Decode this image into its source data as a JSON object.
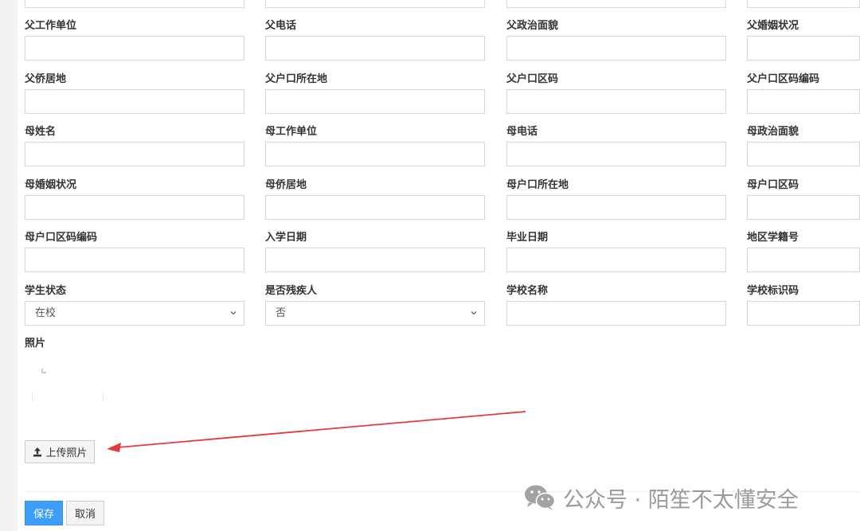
{
  "form": {
    "rows": [
      [
        {
          "label": "父工作单位",
          "value": ""
        },
        {
          "label": "父电话",
          "value": ""
        },
        {
          "label": "父政治面貌",
          "value": ""
        },
        {
          "label": "父婚姻状况",
          "value": ""
        }
      ],
      [
        {
          "label": "父侨居地",
          "value": ""
        },
        {
          "label": "父户口所在地",
          "value": ""
        },
        {
          "label": "父户口区码",
          "value": ""
        },
        {
          "label": "父户口区码编码",
          "value": ""
        }
      ],
      [
        {
          "label": "母姓名",
          "value": ""
        },
        {
          "label": "母工作单位",
          "value": ""
        },
        {
          "label": "母电话",
          "value": ""
        },
        {
          "label": "母政治面貌",
          "value": ""
        }
      ],
      [
        {
          "label": "母婚姻状况",
          "value": ""
        },
        {
          "label": "母侨居地",
          "value": ""
        },
        {
          "label": "母户口所在地",
          "value": ""
        },
        {
          "label": "母户口区码",
          "value": ""
        }
      ],
      [
        {
          "label": "母户口区码编码",
          "value": ""
        },
        {
          "label": "入学日期",
          "value": ""
        },
        {
          "label": "毕业日期",
          "value": ""
        },
        {
          "label": "地区学籍号",
          "value": ""
        }
      ],
      [
        {
          "label": "学生状态",
          "value": "在校",
          "type": "select"
        },
        {
          "label": "是否残疾人",
          "value": "否",
          "type": "select"
        },
        {
          "label": "学校名称",
          "value": ""
        },
        {
          "label": "学校标识码",
          "value": ""
        }
      ]
    ]
  },
  "photo": {
    "label": "照片",
    "upload_button": "上传照片",
    "upload_icon": "upload-icon"
  },
  "actions": {
    "save": "保存",
    "cancel": "取消"
  },
  "watermark": {
    "text": "公众号 · 陌笙不太懂安全",
    "icon": "wechat-icon"
  },
  "colors": {
    "primary": "#3c9ef7",
    "annotation_arrow": "#e8383d",
    "border": "#d6d6d6"
  }
}
